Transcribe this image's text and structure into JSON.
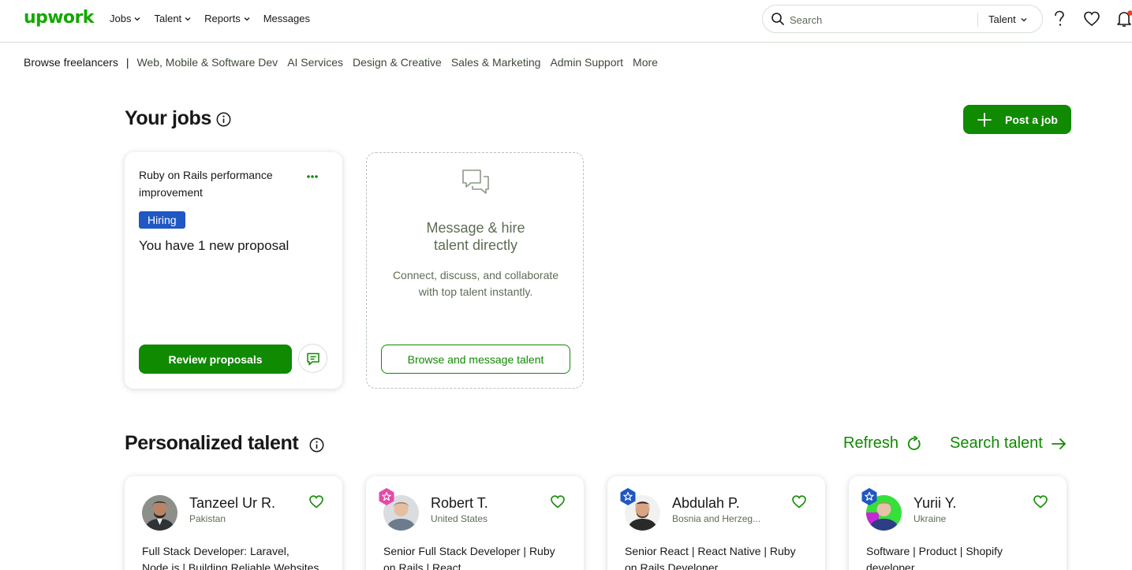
{
  "brand": {
    "logo": "upwork",
    "accent": "#108a00",
    "logo_color": "#14a800"
  },
  "nav": {
    "items": [
      {
        "label": "Jobs",
        "has_dropdown": true
      },
      {
        "label": "Talent",
        "has_dropdown": true
      },
      {
        "label": "Reports",
        "has_dropdown": true
      },
      {
        "label": "Messages",
        "has_dropdown": false
      }
    ],
    "search": {
      "placeholder": "Search",
      "scope": "Talent"
    },
    "icons": [
      "help-icon",
      "heart-icon",
      "notification-bell-icon"
    ]
  },
  "subnav": {
    "lead": "Browse freelancers",
    "separator": "|",
    "items": [
      "Web, Mobile & Software Dev",
      "AI Services",
      "Design & Creative",
      "Sales & Marketing",
      "Admin Support",
      "More"
    ]
  },
  "jobs": {
    "title": "Your jobs",
    "post_button": "Post a job",
    "job_card": {
      "title": "Ruby on Rails performance improvement",
      "badge": "Hiring",
      "badge_color": "#1f57c3",
      "status": "You have 1 new proposal",
      "review_button": "Review proposals"
    },
    "message_card": {
      "title_line1": "Message & hire",
      "title_line2": "talent directly",
      "desc_line1": "Connect, discuss, and collaborate",
      "desc_line2": "with top talent instantly.",
      "button": "Browse and message talent"
    }
  },
  "talent": {
    "title": "Personalized talent",
    "refresh": "Refresh",
    "search": "Search talent",
    "cards": [
      {
        "name": "Tanzeel Ur R.",
        "location": "Pakistan",
        "badge": "none",
        "desc": "Full Stack Developer: Laravel, Node.js | Building Reliable Websites"
      },
      {
        "name": "Robert T.",
        "location": "United States",
        "badge": "pink-star-badge",
        "desc": "Senior Full Stack Developer | Ruby on Rails | React"
      },
      {
        "name": "Abdulah P.",
        "location": "Bosnia and Herzeg...",
        "badge": "blue-star-badge",
        "desc": "Senior React | React Native | Ruby on Rails Developer"
      },
      {
        "name": "Yurii Y.",
        "location": "Ukraine",
        "badge": "blue-star-badge",
        "desc": "Software | Product | Shopify developer"
      }
    ]
  }
}
